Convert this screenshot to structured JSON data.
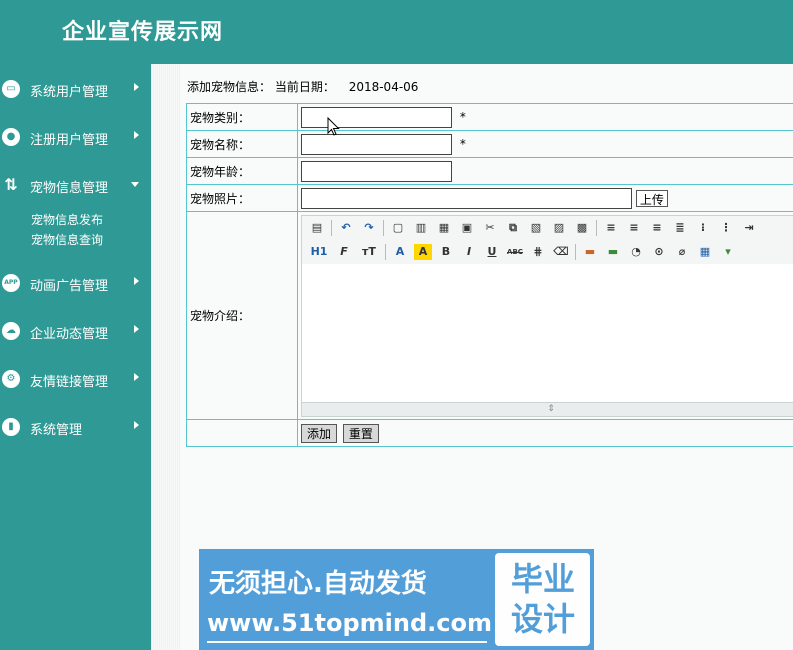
{
  "site": {
    "title": "企业宣传展示网"
  },
  "sidebar": {
    "items": [
      {
        "label": "系统用户管理",
        "icon": "monitor-icon",
        "expanded": false
      },
      {
        "label": "注册用户管理",
        "icon": "user-gear-icon",
        "expanded": false
      },
      {
        "label": "宠物信息管理",
        "icon": "transfer-arrows-icon",
        "expanded": true,
        "children": [
          {
            "label": "宠物信息发布"
          },
          {
            "label": "宠物信息查询"
          }
        ]
      },
      {
        "label": "动画广告管理",
        "icon": "app-icon",
        "expanded": false
      },
      {
        "label": "企业动态管理",
        "icon": "cloud-icon",
        "expanded": false
      },
      {
        "label": "友情链接管理",
        "icon": "gear-icon",
        "expanded": false
      },
      {
        "label": "系统管理",
        "icon": "bar-chart-icon",
        "expanded": false
      }
    ]
  },
  "page": {
    "heading": "添加宠物信息：",
    "date_label": "当前日期：",
    "date_value": "2018-04-06"
  },
  "form": {
    "category_label": "宠物类别：",
    "category_value": "",
    "name_label": "宠物名称：",
    "name_value": "",
    "age_label": "宠物年龄：",
    "age_value": "",
    "photo_label": "宠物照片：",
    "photo_value": "",
    "upload_button": "上传",
    "intro_label": "宠物介绍：",
    "required_mark": "*",
    "add_button": "添加",
    "reset_button": "重置"
  },
  "editor": {
    "row1_icons": [
      "source-icon",
      "undo-icon",
      "redo-icon",
      "preview-icon",
      "print-icon",
      "template-icon",
      "select-all-icon",
      "cut-icon",
      "copy-icon",
      "paste-icon",
      "paste-text-icon",
      "paste-word-icon",
      "align-left-icon",
      "align-center-icon",
      "align-right-icon",
      "justify-icon",
      "ordered-list-icon",
      "unordered-list-icon",
      "indent-icon"
    ],
    "row2_labels": {
      "heading": "H1",
      "font": "F",
      "size": "тT",
      "fore": "A",
      "back": "A",
      "bold": "B",
      "italic": "I",
      "underline": "U",
      "strike": "ABC"
    },
    "row2_icons": [
      "line-height-icon",
      "remove-format-icon",
      "image-icon",
      "multi-image-icon",
      "flash-icon",
      "media-icon",
      "attachment-icon",
      "table-icon",
      "hr-icon"
    ],
    "resize_glyph": "⇕"
  },
  "watermark": {
    "left_text": "无须担心.自动发货",
    "url": "www.51topmind.com",
    "right_text": "毕业设计",
    "bg_color": "#4a9ad8"
  }
}
